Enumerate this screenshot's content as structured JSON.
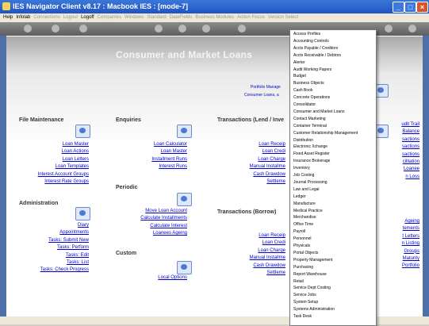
{
  "window": {
    "title": "IES Navigator Client v8.17 : Macbook IES :     [mode-7]"
  },
  "menu": {
    "items": [
      "Help",
      "Infolab",
      "Connections",
      "Logout",
      "Logoff",
      "Companies",
      "Windows",
      "Standard",
      "DataFields",
      "Business Modules",
      "Action Focus",
      "Version Select"
    ],
    "dim": [
      false,
      false,
      true,
      true,
      false,
      true,
      true,
      true,
      true,
      true,
      true,
      true
    ]
  },
  "banner": {
    "title": "Consumer and Market Loans"
  },
  "portal": {
    "line1": "Portfolio Manage",
    "line2": "Consumer Loans, a"
  },
  "file_maintenance": {
    "heading": "File Maintenance",
    "links": [
      "Loan Master",
      "Loan Actions",
      "Loan Letters",
      "Loan Templates",
      "Interest Account Groups",
      "Interest Rate Groups"
    ]
  },
  "administration": {
    "heading": "Administration",
    "links": [
      "Diary",
      "Appointments",
      "Tasks: Submit New",
      "Tasks: Perform",
      "Tasks: Edit",
      "Tasks: List",
      "Tasks: Check Progress"
    ]
  },
  "enquiries": {
    "heading": "Enquiries",
    "links": [
      "Loan Calculator",
      "Loan Master",
      "Installment Runs",
      "Interest Runs"
    ]
  },
  "periodic": {
    "heading": "Periodic",
    "links": [
      "Move Loan Account",
      "Calculate Installments",
      "Calculate Interest",
      "Loanees Ageing"
    ]
  },
  "custom": {
    "heading": "Custom",
    "links": [
      "Local Options"
    ]
  },
  "transactions_lend": {
    "heading": "Transactions (Lend / Inve",
    "links": [
      "Loan Receip",
      "Loan Credi",
      "Loan Charge",
      "Manual Installme",
      "Cash Drawdow",
      "Settleme"
    ]
  },
  "transactions_borrow": {
    "heading": "Transactions (Borrow)",
    "links": [
      "Loan Receip",
      "Loan Credi",
      "Loan Charge",
      "Manual Installme",
      "Cash Drawdow",
      "Settleme"
    ]
  },
  "right_links": {
    "top": [
      "udit Trail",
      "Balance",
      "sactions",
      "sactions",
      "sactions",
      "cilliation",
      "Loanee",
      "n Loss"
    ],
    "bottom": [
      "Ageing",
      "tements",
      "t Letters",
      "n Listing",
      "Groups",
      "Maturity",
      "Portfolio"
    ]
  },
  "dropdown": {
    "items": [
      "Access Profiles",
      "Accounting Controls",
      "Accts Payable / Creditors",
      "Accts Receivable / Debtors",
      "Alerter",
      "Audit Working Papers",
      "Budget",
      "Business Objects",
      "Cash Book",
      "Concrete Operations",
      "Consolidator",
      "Consumer and Market Loans",
      "Contact Marketing",
      "Container Terminal",
      "Customer Relationship Management",
      "Distribution",
      "Electronic Xchange",
      "Fixed Asset Register",
      "Insurance Brokerage",
      "Inventory",
      "Job Costing",
      "Journal Processing",
      "Law and Legal",
      "Ledger",
      "Manufacture",
      "Medical Practice",
      "Merchandise",
      "Office Time",
      "Payroll",
      "Personnel",
      "Physicals",
      "Portal Objects",
      "Property Management",
      "Purchasing",
      "Report Warehouse",
      "Retail",
      "Service Dept Costing",
      "Service Jobs",
      "System Setup",
      "Systems Administration",
      "Task Desk"
    ]
  }
}
